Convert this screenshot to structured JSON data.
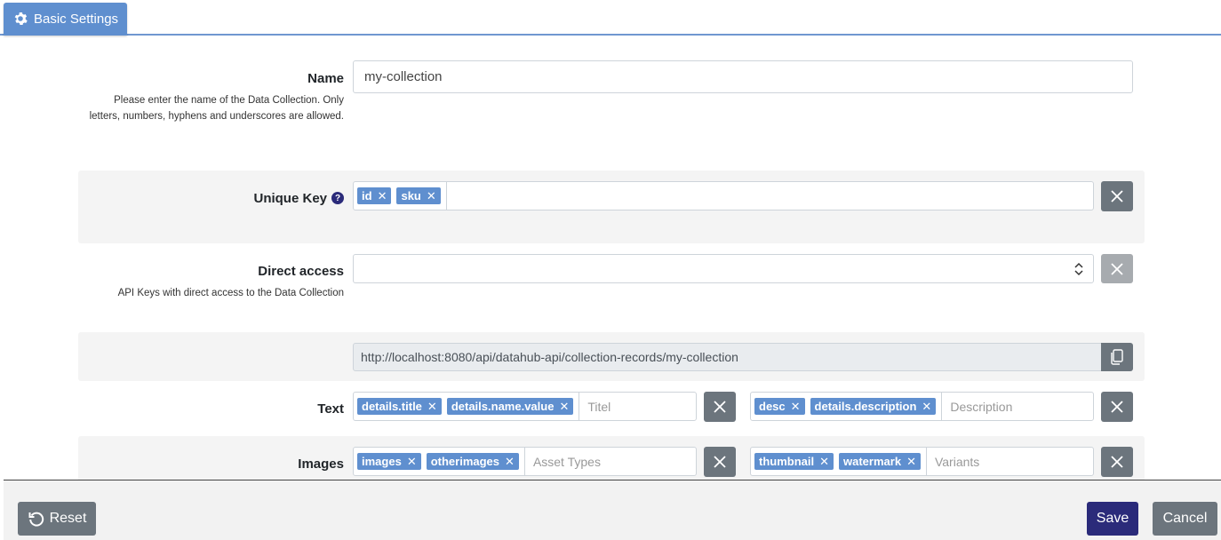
{
  "tabs": [
    {
      "label": "Basic Settings",
      "icon": "gear-icon"
    }
  ],
  "name": {
    "label": "Name",
    "help": "Please enter the name of the Data Collection. Only letters, numbers, hyphens and underscores are allowed.",
    "value": "my-collection"
  },
  "unique_key": {
    "label": "Unique Key",
    "help_icon": "?",
    "tags": [
      "id",
      "sku"
    ]
  },
  "direct_access": {
    "label": "Direct access",
    "help": "API Keys with direct access to the Data Collection",
    "value": ""
  },
  "endpoint": {
    "url": "http://localhost:8080/api/datahub-api/collection-records/my-collection"
  },
  "text": {
    "label": "Text",
    "left_tags": [
      "details.title",
      "details.name.value"
    ],
    "left_placeholder": "Titel",
    "right_tags": [
      "desc",
      "details.description"
    ],
    "right_placeholder": "Description"
  },
  "images": {
    "label": "Images",
    "left_tags": [
      "images",
      "otherimages"
    ],
    "left_placeholder": "Asset Types",
    "right_tags": [
      "thumbnail",
      "watermark"
    ],
    "right_placeholder": "Variants"
  },
  "footer": {
    "reset_label": "Reset",
    "save_label": "Save",
    "cancel_label": "Cancel"
  },
  "colors": {
    "accent": "#5f8fcf",
    "save": "#2b2b7a",
    "secondary": "#6c757d"
  }
}
